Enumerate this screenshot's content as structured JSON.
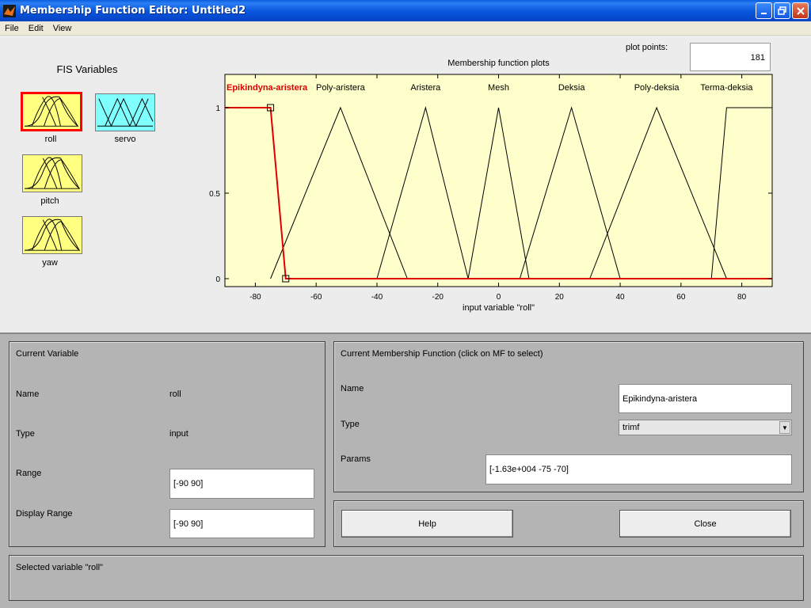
{
  "window": {
    "title": "Membership Function Editor: Untitled2"
  },
  "menu": [
    "File",
    "Edit",
    "View"
  ],
  "fis": {
    "title": "FIS Variables",
    "variables": [
      {
        "label": "roll",
        "selected": true,
        "color": "#ffff80"
      },
      {
        "label": "servo",
        "selected": false,
        "color": "#80ffff"
      },
      {
        "label": "pitch",
        "selected": false,
        "color": "#ffff80"
      },
      {
        "label": "yaw",
        "selected": false,
        "color": "#ffff80"
      }
    ]
  },
  "plot_points": {
    "label": "plot points:",
    "value": "181"
  },
  "chart_data": {
    "type": "line",
    "title": "Membership function plots",
    "xlabel": "input variable \"roll\"",
    "xlim": [
      -90,
      90
    ],
    "ylim": [
      0,
      1
    ],
    "xticks": [
      -80,
      -60,
      -40,
      -20,
      0,
      20,
      40,
      60,
      80
    ],
    "yticks": [
      0,
      0.5,
      1
    ],
    "xtick_labels": [
      "-80",
      "-60",
      "-40",
      "-20",
      "0",
      "20",
      "40",
      "60",
      "80"
    ],
    "ytick_labels": [
      "0",
      "0.5",
      "1"
    ],
    "selected_color": "#dd0000",
    "series": [
      {
        "name": "Epikindyna-aristera",
        "label_x": -75,
        "points": [
          [
            -90,
            1
          ],
          [
            -75,
            1
          ],
          [
            -70,
            0
          ],
          [
            90,
            0
          ]
        ],
        "selected": true
      },
      {
        "name": "Poly-aristera",
        "label_x": -52,
        "points": [
          [
            -75,
            0
          ],
          [
            -52,
            1
          ],
          [
            -30,
            0
          ]
        ]
      },
      {
        "name": "Aristera",
        "label_x": -24,
        "points": [
          [
            -40,
            0
          ],
          [
            -24,
            1
          ],
          [
            -10,
            0
          ]
        ]
      },
      {
        "name": "Mesh",
        "label_x": 0,
        "points": [
          [
            -10,
            0
          ],
          [
            0,
            1
          ],
          [
            10,
            0
          ]
        ]
      },
      {
        "name": "Deksia",
        "label_x": 24,
        "points": [
          [
            7,
            0
          ],
          [
            24,
            1
          ],
          [
            40,
            0
          ]
        ]
      },
      {
        "name": "Poly-deksia",
        "label_x": 52,
        "points": [
          [
            30,
            0
          ],
          [
            52,
            1
          ],
          [
            75,
            0
          ]
        ]
      },
      {
        "name": "Terma-deksia",
        "label_x": 75,
        "points": [
          [
            70,
            0
          ],
          [
            75,
            1
          ],
          [
            90,
            1
          ]
        ]
      }
    ]
  },
  "current_variable": {
    "title": "Current Variable",
    "name_label": "Name",
    "name_value": "roll",
    "type_label": "Type",
    "type_value": "input",
    "range_label": "Range",
    "range_value": "[-90 90]",
    "display_range_label": "Display Range",
    "display_range_value": "[-90 90]"
  },
  "current_mf": {
    "title": "Current Membership Function (click on MF to select)",
    "name_label": "Name",
    "name_value": "Epikindyna-aristera",
    "type_label": "Type",
    "type_value": "trimf",
    "params_label": "Params",
    "params_value": "[-1.63e+004 -75 -70]"
  },
  "buttons": {
    "help": "Help",
    "close": "Close"
  },
  "status": "Selected variable \"roll\""
}
